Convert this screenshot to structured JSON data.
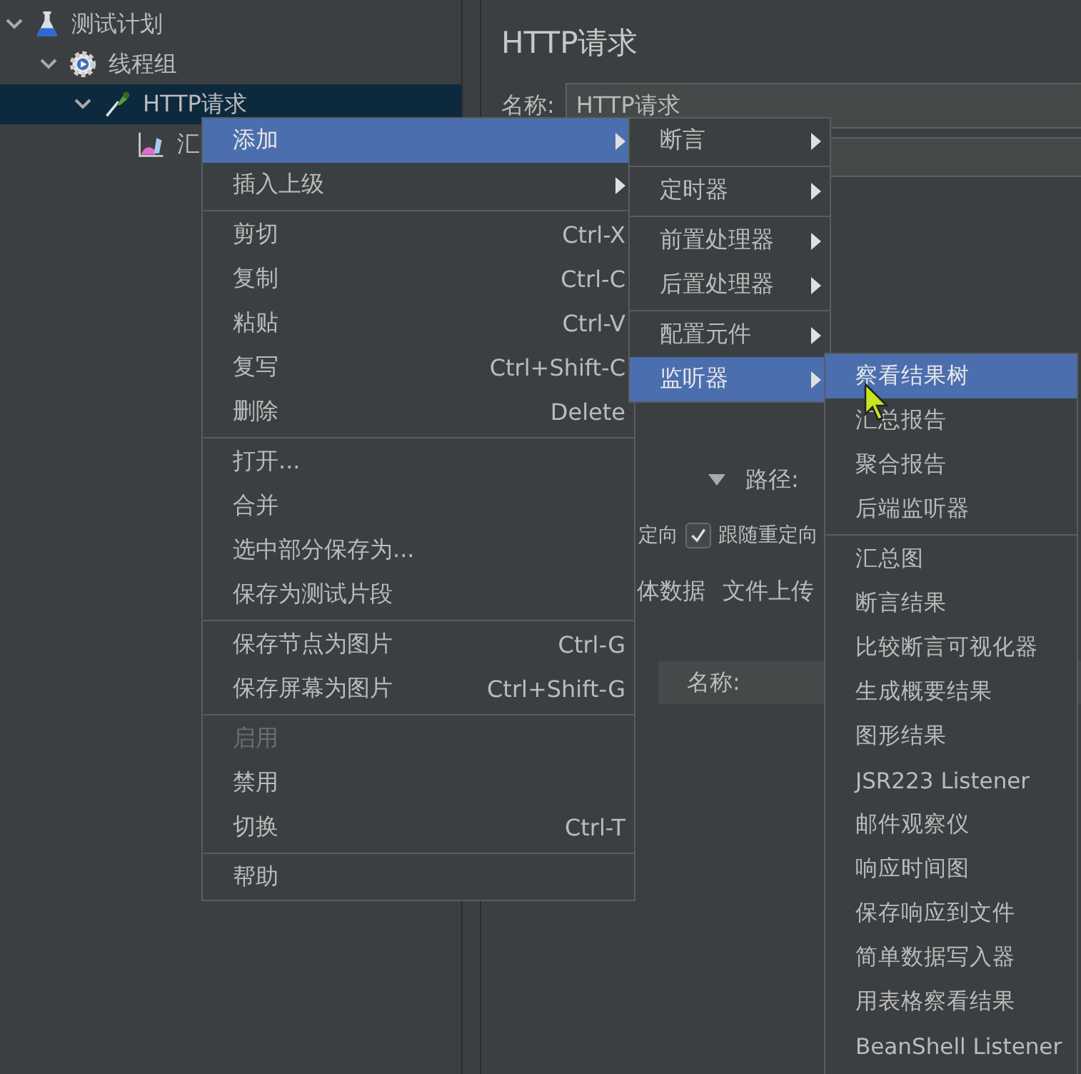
{
  "tree": [
    {
      "label": "测试计划",
      "kind": "test-plan",
      "expanded": true,
      "selected": false,
      "children": [
        {
          "label": "线程组",
          "kind": "thread-group",
          "expanded": true,
          "selected": false,
          "children": [
            {
              "label": "HTTP请求",
              "kind": "sampler",
              "expanded": true,
              "selected": true,
              "children": [
                {
                  "label": "汇",
                  "kind": "listener",
                  "selected": false
                }
              ]
            }
          ]
        }
      ]
    }
  ],
  "editor": {
    "title": "HTTP请求",
    "name_label": "名称:",
    "name_value": "HTTP请求",
    "path_label": "路径:",
    "redirect_fragment": "定向",
    "follow_redirects": {
      "label": "跟随重定向",
      "checked": true
    },
    "tab_fragments": [
      "体数据",
      "文件上传"
    ],
    "table_header": "名称:"
  },
  "context_menu": [
    {
      "label": "添加",
      "kind": "submenu",
      "selected": true
    },
    {
      "label": "插入上级",
      "kind": "submenu",
      "selected": false
    },
    {
      "label": "剪切",
      "kind": "action",
      "shortcut": "Ctrl-X",
      "selected": false,
      "separator_before": true
    },
    {
      "label": "复制",
      "kind": "action",
      "shortcut": "Ctrl-C",
      "selected": false
    },
    {
      "label": "粘贴",
      "kind": "action",
      "shortcut": "Ctrl-V",
      "selected": false
    },
    {
      "label": "复写",
      "kind": "action",
      "shortcut": "Ctrl+Shift-C",
      "selected": false
    },
    {
      "label": "删除",
      "kind": "action",
      "shortcut": "Delete",
      "selected": false
    },
    {
      "label": "打开...",
      "kind": "action",
      "selected": false,
      "separator_before": true
    },
    {
      "label": "合并",
      "kind": "action",
      "selected": false
    },
    {
      "label": "选中部分保存为...",
      "kind": "action",
      "selected": false
    },
    {
      "label": "保存为测试片段",
      "kind": "action",
      "selected": false
    },
    {
      "label": "保存节点为图片",
      "kind": "action",
      "shortcut": "Ctrl-G",
      "selected": false,
      "separator_before": true
    },
    {
      "label": "保存屏幕为图片",
      "kind": "action",
      "shortcut": "Ctrl+Shift-G",
      "selected": false
    },
    {
      "label": "启用",
      "kind": "action",
      "selected": false,
      "disabled": true,
      "separator_before": true
    },
    {
      "label": "禁用",
      "kind": "action",
      "selected": false
    },
    {
      "label": "切换",
      "kind": "action",
      "shortcut": "Ctrl-T",
      "selected": false
    },
    {
      "label": "帮助",
      "kind": "action",
      "selected": false,
      "separator_before": true
    }
  ],
  "add_submenu": [
    {
      "label": "断言",
      "kind": "submenu",
      "selected": false
    },
    {
      "label": "定时器",
      "kind": "submenu",
      "selected": false,
      "separator_before": true
    },
    {
      "label": "前置处理器",
      "kind": "submenu",
      "selected": false,
      "separator_before": true
    },
    {
      "label": "后置处理器",
      "kind": "submenu",
      "selected": false
    },
    {
      "label": "配置元件",
      "kind": "submenu",
      "selected": false,
      "separator_before": true
    },
    {
      "label": "监听器",
      "kind": "submenu",
      "selected": true
    }
  ],
  "listener_submenu": [
    {
      "label": "察看结果树",
      "kind": "action",
      "selected": true
    },
    {
      "label": "汇总报告",
      "kind": "action",
      "selected": false
    },
    {
      "label": "聚合报告",
      "kind": "action",
      "selected": false
    },
    {
      "label": "后端监听器",
      "kind": "action",
      "selected": false
    },
    {
      "label": "汇总图",
      "kind": "action",
      "selected": false,
      "separator_before": true
    },
    {
      "label": "断言结果",
      "kind": "action",
      "selected": false
    },
    {
      "label": "比较断言可视化器",
      "kind": "action",
      "selected": false
    },
    {
      "label": "生成概要结果",
      "kind": "action",
      "selected": false
    },
    {
      "label": "图形结果",
      "kind": "action",
      "selected": false
    },
    {
      "label": "JSR223 Listener",
      "kind": "action",
      "selected": false
    },
    {
      "label": "邮件观察仪",
      "kind": "action",
      "selected": false
    },
    {
      "label": "响应时间图",
      "kind": "action",
      "selected": false
    },
    {
      "label": "保存响应到文件",
      "kind": "action",
      "selected": false
    },
    {
      "label": "简单数据写入器",
      "kind": "action",
      "selected": false
    },
    {
      "label": "用表格察看结果",
      "kind": "action",
      "selected": false
    },
    {
      "label": "BeanShell Listener",
      "kind": "action",
      "selected": false
    }
  ]
}
